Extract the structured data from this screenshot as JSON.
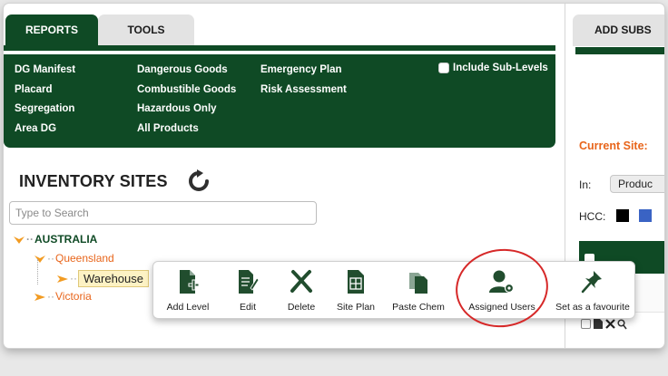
{
  "tabs": {
    "reports": "REPORTS",
    "tools": "TOOLS",
    "add_substance": "ADD SUBS"
  },
  "reports_menu": {
    "col1": [
      "DG Manifest",
      "Placard",
      "Segregation",
      "Area DG"
    ],
    "col2": [
      "Dangerous Goods",
      "Combustible Goods",
      "Hazardous Only",
      "All Products"
    ],
    "col3": [
      "Emergency Plan",
      "Risk Assessment"
    ],
    "include_sublevels": "Include Sub-Levels"
  },
  "inventory": {
    "title": "INVENTORY SITES",
    "search_placeholder": "Type to Search",
    "tree": {
      "australia": "AUSTRALIA",
      "queensland": "Queensland",
      "warehouse": "Warehouse",
      "victoria": "Victoria"
    }
  },
  "context_menu": {
    "add_level": "Add Level",
    "edit": "Edit",
    "delete": "Delete",
    "site_plan": "Site Plan",
    "paste_chem": "Paste Chem",
    "assigned_users": "Assigned Users",
    "set_favourite": "Set as a favourite"
  },
  "right_panel": {
    "current_site_label": "Current Site:",
    "in_label": "In:",
    "in_value": "Produc",
    "hcc_label": "HCC:"
  },
  "colors": {
    "brand_green": "#0f4a25",
    "accent_orange": "#e8651b",
    "highlight_red": "#d62828"
  }
}
